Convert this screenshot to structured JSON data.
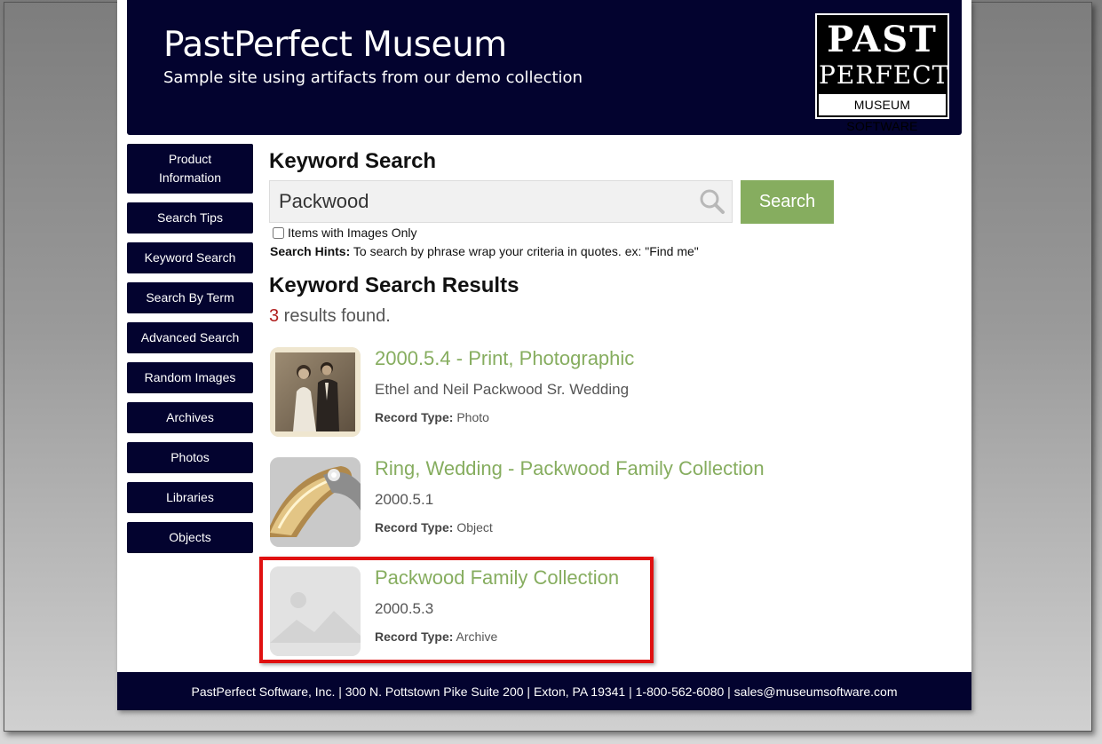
{
  "header": {
    "title": "PastPerfect Museum",
    "subtitle": "Sample site using artifacts from our demo collection",
    "logo": {
      "line1": "PAST",
      "line2": "PERFECT",
      "line3": "MUSEUM SOFTWARE"
    }
  },
  "sidebar": {
    "items": [
      {
        "label": "Product Information"
      },
      {
        "label": "Search Tips"
      },
      {
        "label": "Keyword Search"
      },
      {
        "label": "Search By Term"
      },
      {
        "label": "Advanced Search"
      },
      {
        "label": "Random Images"
      },
      {
        "label": "Archives"
      },
      {
        "label": "Photos"
      },
      {
        "label": "Libraries"
      },
      {
        "label": "Objects"
      }
    ]
  },
  "search": {
    "heading": "Keyword Search",
    "value": "Packwood",
    "button_label": "Search",
    "images_only_label": "Items with Images Only",
    "hints_label": "Search Hints:",
    "hints_text": " To search by phrase wrap your criteria in quotes. ex: \"Find me\""
  },
  "results": {
    "heading": "Keyword Search Results",
    "count": "3",
    "count_suffix": " results found.",
    "record_type_label": "Record Type:",
    "items": [
      {
        "title": "2000.5.4 - Print, Photographic",
        "subtitle": "Ethel and Neil Packwood Sr. Wedding",
        "record_type": " Photo",
        "thumb": "wedding-photo"
      },
      {
        "title": "Ring, Wedding - Packwood Family Collection",
        "subtitle": "2000.5.1",
        "record_type": " Object",
        "thumb": "wedding-ring"
      },
      {
        "title": "Packwood Family Collection",
        "subtitle": "2000.5.3",
        "record_type": " Archive",
        "thumb": "image-placeholder-icon"
      }
    ]
  },
  "footer": {
    "text": "PastPerfect Software, Inc. | 300 N. Pottstown Pike Suite 200 | Exton, PA 19341 | 1-800-562-6080 | sales@museumsoftware.com"
  },
  "colors": {
    "navy": "#03032f",
    "accent_green": "#86ad5f",
    "count_red": "#b01f1f",
    "highlight_red": "#e01010"
  }
}
